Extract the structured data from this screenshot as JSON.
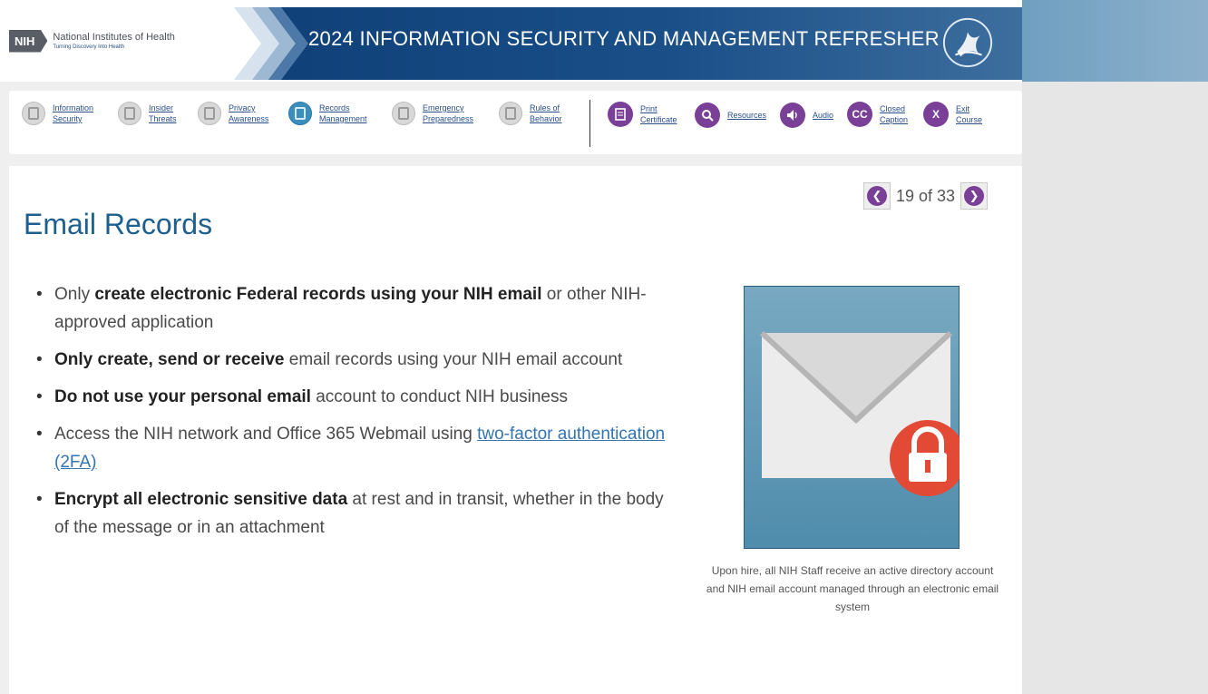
{
  "header": {
    "logo_abbrev": "NIH",
    "logo_name": "National Institutes of Health",
    "logo_tagline": "Turning Discovery Into Health",
    "banner_title": "2024 INFORMATION SECURITY AND MANAGEMENT REFRESHER",
    "seal_icon": "hhs-seal-icon"
  },
  "nav": {
    "modules": [
      {
        "line1": "Information",
        "line2": "Security",
        "active": false
      },
      {
        "line1": "Insider",
        "line2": "Threats",
        "active": false
      },
      {
        "line1": "Privacy",
        "line2": "Awareness",
        "active": false
      },
      {
        "line1": "Records",
        "line2": "Management",
        "active": true
      },
      {
        "line1": "Emergency",
        "line2": "Preparedness",
        "active": false
      },
      {
        "line1": "Rules of",
        "line2": "Behavior",
        "active": false
      }
    ],
    "tools": [
      {
        "line1": "Print",
        "line2": "Certificate",
        "icon": "document-icon"
      },
      {
        "line1": "Resources",
        "line2": "",
        "icon": "search-icon"
      },
      {
        "line1": "Audio",
        "line2": "",
        "icon": "speaker-icon"
      },
      {
        "line1": "Closed",
        "line2": "Caption",
        "icon": "closed-caption-icon",
        "glyph": "CC"
      },
      {
        "line1": "Exit",
        "line2": "Course",
        "icon": "exit-icon",
        "glyph": "X"
      }
    ]
  },
  "pager": {
    "label": "19 of 33",
    "current": 19,
    "total": 33
  },
  "main": {
    "title": "Email Records",
    "bullets": [
      {
        "pre": "Only ",
        "bold": "create electronic Federal records using your NIH email",
        "post": " or other NIH-approved application",
        "link": ""
      },
      {
        "pre": "",
        "bold": "Only create, send or receive",
        "post": " email records using your NIH email account",
        "link": ""
      },
      {
        "pre": "",
        "bold": "Do not use your personal email",
        "post": " account to conduct NIH business",
        "link": ""
      },
      {
        "pre": "Access the NIH network and Office 365 Webmail using ",
        "bold": "",
        "post": "",
        "link": "two-factor authentication (2FA)"
      },
      {
        "pre": "",
        "bold": "Encrypt all electronic sensitive data",
        "post": " at rest and in transit, whether in the body of the message or in an attachment",
        "link": ""
      }
    ],
    "image_caption": "Upon hire, all NIH Staff receive an active directory account and NIH email account managed through an electronic email system"
  },
  "colors": {
    "banner": "#1a4f88",
    "title": "#1d5f8e",
    "accent_purple": "#7a3f96",
    "lock_red": "#e24a36",
    "active_module": "#3b8ebc"
  }
}
